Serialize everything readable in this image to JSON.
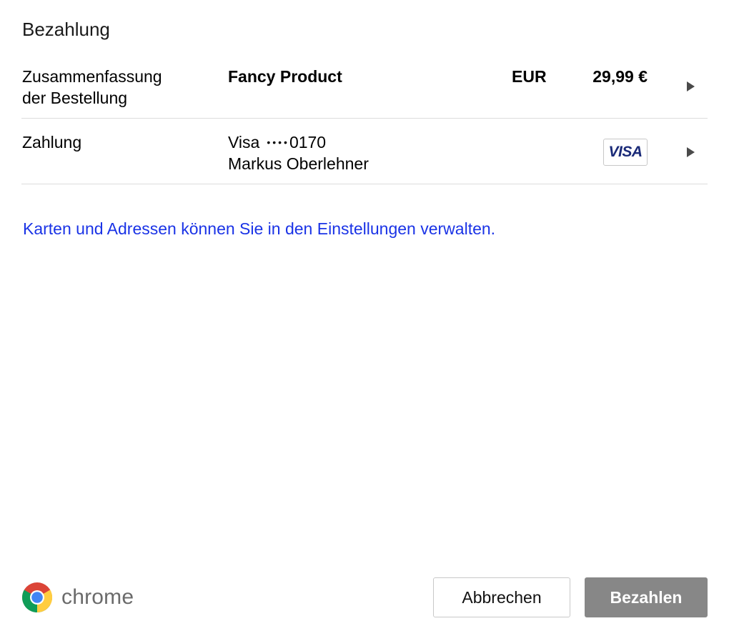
{
  "dialog": {
    "title": "Bezahlung"
  },
  "summary": {
    "label_line1": "Zusammenfassung",
    "label_line2": "der Bestellung",
    "product": "Fancy Product",
    "currency": "EUR",
    "amount": "29,99 €"
  },
  "payment": {
    "label": "Zahlung",
    "card_brand": "Visa",
    "card_mask": "••••",
    "card_last4": "0170",
    "cardholder": "Markus Oberlehner",
    "badge_text": "VISA"
  },
  "settings_link": "Karten und Adressen können Sie in den Einstellungen verwalten.",
  "footer": {
    "brand": "chrome",
    "cancel_label": "Abbrechen",
    "pay_label": "Bezahlen"
  },
  "colors": {
    "link": "#1a33e6",
    "pay_button_bg": "#878787",
    "visa_blue": "#1a2a78"
  },
  "icons": {
    "brand_logo": "chrome-logo-icon",
    "row_chevron": "chevron-right-icon",
    "card_badge": "visa-card-icon"
  }
}
